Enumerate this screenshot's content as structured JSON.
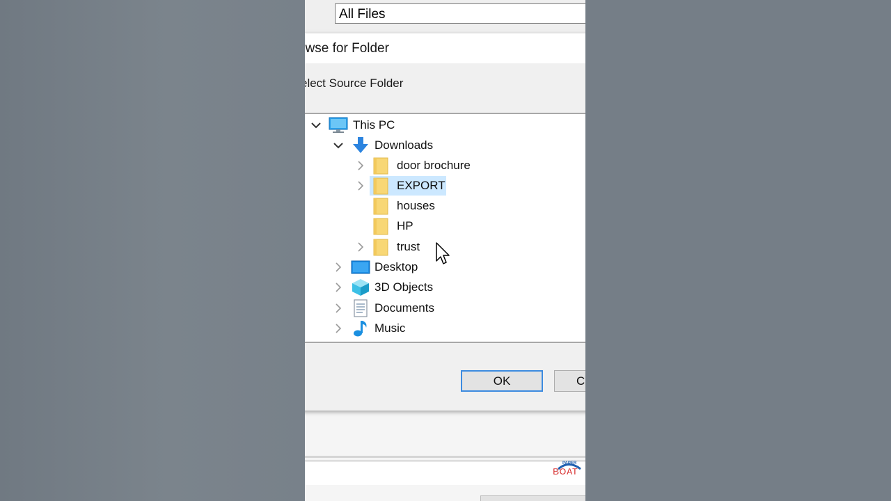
{
  "background_window": {
    "file_type_filter": "All Files"
  },
  "dialog": {
    "title": "owse for Folder",
    "description": "elect Source Folder",
    "ok_label": "OK",
    "cancel_label": "C"
  },
  "tree": {
    "this_pc": "This PC",
    "downloads": "Downloads",
    "door_brochure": "door brochure",
    "export": "EXPORT",
    "houses": "houses",
    "hp": "HP",
    "trust": "trust",
    "desktop": "Desktop",
    "objects_3d": "3D Objects",
    "documents": "Documents",
    "music": "Music"
  },
  "logo": {
    "top_text": "PAPER",
    "bottom_text": "BOAT"
  },
  "colors": {
    "selection": "#cce8ff",
    "folder": "#f8d775",
    "accent_blue": "#3c8be0"
  }
}
